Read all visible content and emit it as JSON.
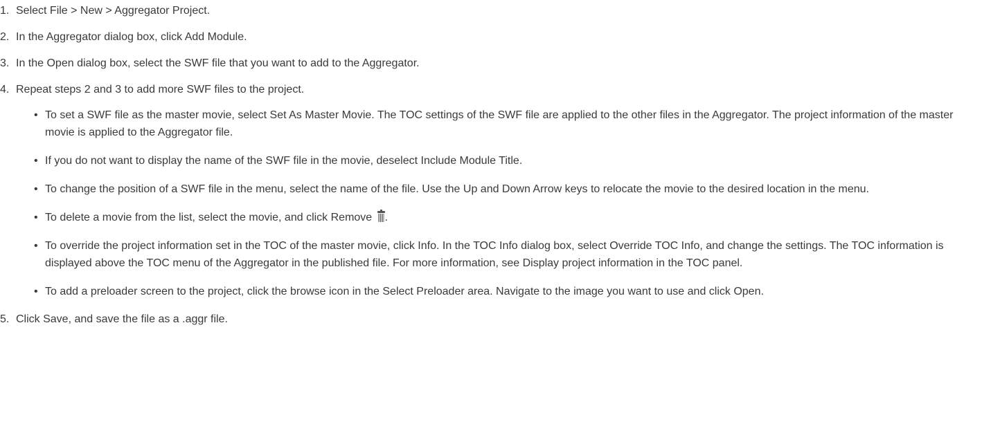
{
  "steps": [
    {
      "num": "1.",
      "text": "Select File > New > Aggregator Project."
    },
    {
      "num": "2.",
      "text": "In the Aggregator dialog box, click Add Module."
    },
    {
      "num": "3.",
      "text": "In the Open dialog box, select the SWF file that you want to add to the Aggregator."
    },
    {
      "num": "4.",
      "text": "Repeat steps 2 and 3 to add more SWF files to the project."
    },
    {
      "num": "5.",
      "text": "Click Save, and save the file as a .aggr file."
    }
  ],
  "bullet_glyph": "•",
  "bullets": [
    {
      "text": "To set a SWF file as the master movie, select Set As Master Movie. The TOC settings of the SWF file are applied to the other files in the Aggregator. The project information of the master movie is applied to the Aggregator file."
    },
    {
      "text": "If you do not want to display the name of the SWF file in the movie, deselect Include Module Title."
    },
    {
      "text": "To change the position of a SWF file in the menu, select the name of the file. Use the Up and Down Arrow keys to relocate the movie to the desired location in the menu."
    },
    {
      "text": "To delete a movie from the list, select the movie, and click Remove ",
      "icon": "trash-icon",
      "after": "."
    },
    {
      "text": "To override the project information set in the TOC of the master movie, click Info. In the TOC Info dialog box, select Override TOC Info, and change the settings. The TOC information is displayed above the TOC menu of the Aggregator in the published file. For more information, see Display project information in the TOC panel."
    },
    {
      "text": "To add a preloader screen to the project, click the browse icon in the Select Preloader area. Navigate to the image you want to use and click Open."
    }
  ]
}
